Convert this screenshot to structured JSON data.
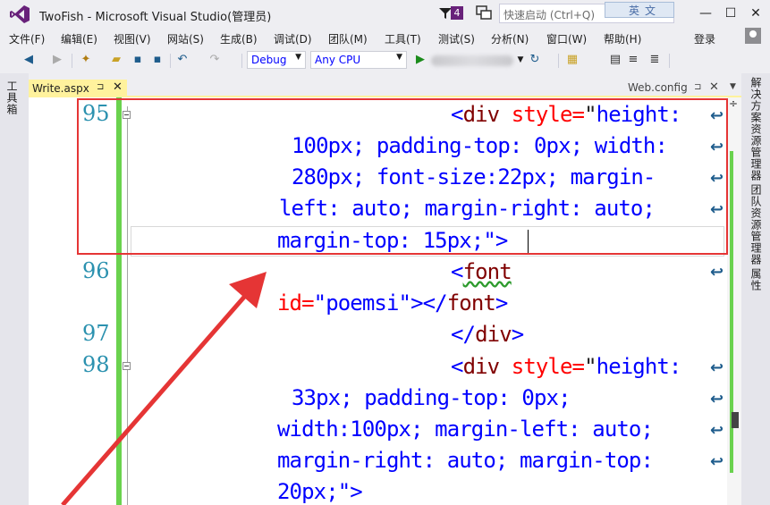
{
  "titlebar": {
    "app_title": "TwoFish - Microsoft Visual Studio(管理员)",
    "notification_count": "4",
    "quick_launch_placeholder": "快速启动 (Ctrl+Q)",
    "ime_text": "英文",
    "minimize": "—",
    "maximize": "☐",
    "close": "✕"
  },
  "menu": {
    "items": [
      "文件(F)",
      "编辑(E)",
      "视图(V)",
      "网站(S)",
      "生成(B)",
      "调试(D)",
      "团队(M)",
      "工具(T)",
      "测试(S)",
      "分析(N)",
      "窗口(W)",
      "帮助(H)"
    ],
    "sign_in": "登录"
  },
  "toolbar": {
    "config": "Debug",
    "platform": "Any CPU",
    "start_glyph": "▶"
  },
  "left_strip": {
    "toolbox": "工具箱"
  },
  "right_strip": {
    "solution_explorer": "解决方案资源管理器",
    "team_explorer": "团队资源管理器",
    "properties": "属性"
  },
  "tabs": {
    "active": "Write.aspx",
    "other": "Web.config"
  },
  "editor": {
    "line_numbers": {
      "l95": "95",
      "l96": "96",
      "l97": "97",
      "l98": "98"
    },
    "lines": {
      "r0_open": "<",
      "r0_tag": "div",
      "r0_attr": " style=",
      "r0_q": "\"",
      "r0_val": "height:",
      "r1_val": "100px; padding-top: 0px; width:",
      "r2_val": "280px; font-size:22px; margin-",
      "r3_val": "left: auto; margin-right: auto;",
      "r4_attr": "margin-top: 15px;",
      "r4_close": "\">",
      "r5_open": "<",
      "r5_tag": "font",
      "r6_attr": "id=",
      "r6_val": "\"poemsi\"",
      "r6_rest": "></",
      "r6_tag": "font",
      "r6_end": ">",
      "r7_open": "</",
      "r7_tag": "div",
      "r7_end": ">",
      "r8_open": "<",
      "r8_tag": "div",
      "r8_attr": " style=",
      "r8_q": "\"",
      "r8_val": "height:",
      "r9_val": "33px; padding-top: 0px;",
      "r10_val": "width:100px; margin-left: auto;",
      "r11_val": "margin-right: auto; margin-top:",
      "r12_val": "20px;",
      "r12_close": "\">"
    },
    "wrap_glyph": "↩"
  },
  "colors": {
    "tag": "#800000",
    "attribute": "#ff0000",
    "value": "#0000ff",
    "line_number": "#2b91af",
    "change_margin": "#6ad24e",
    "annotation": "#e53535",
    "active_tab": "#fff29d"
  }
}
